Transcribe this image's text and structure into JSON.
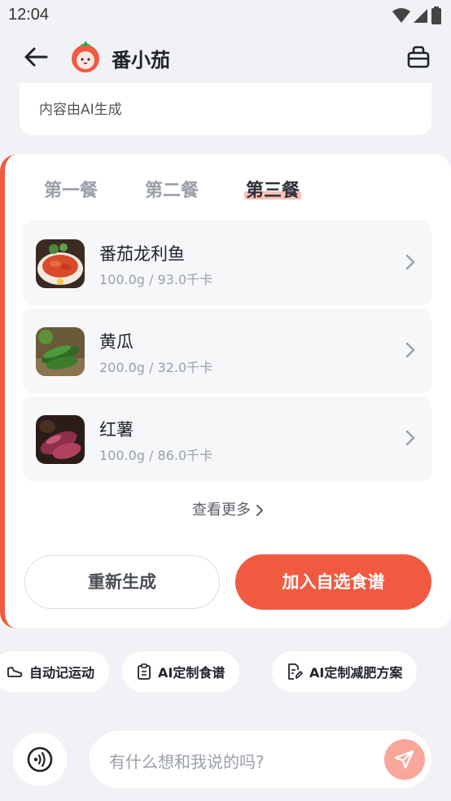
{
  "status_bar": {
    "time": "12:04"
  },
  "app_bar": {
    "title": "番小茄"
  },
  "previous_message": {
    "text": "内容由AI生成"
  },
  "meal_tabs": [
    {
      "label": "第一餐",
      "active": false
    },
    {
      "label": "第二餐",
      "active": false
    },
    {
      "label": "第三餐",
      "active": true
    }
  ],
  "food_items": [
    {
      "name": "番茄龙利鱼",
      "meta": "100.0g / 93.0千卡",
      "image": "tomato-fish-dish"
    },
    {
      "name": "黄瓜",
      "meta": "200.0g / 32.0千卡",
      "image": "cucumber"
    },
    {
      "name": "红薯",
      "meta": "100.0g / 86.0千卡",
      "image": "sweet-potato"
    }
  ],
  "more_link": "查看更多",
  "buttons": {
    "regenerate": "重新生成",
    "add_to_recipes": "加入自选食谱"
  },
  "quick_actions": [
    {
      "label": "自动记运动",
      "icon": "shoe-icon"
    },
    {
      "label": "AI定制食谱",
      "icon": "clipboard-icon"
    },
    {
      "label": "AI定制减肥方案",
      "icon": "document-edit-icon"
    }
  ],
  "input": {
    "placeholder": "有什么想和我说的吗?"
  },
  "colors": {
    "accent": "#F05A41",
    "tab_highlight": "#FBC1B6",
    "send_inactive": "#F9A79A"
  }
}
